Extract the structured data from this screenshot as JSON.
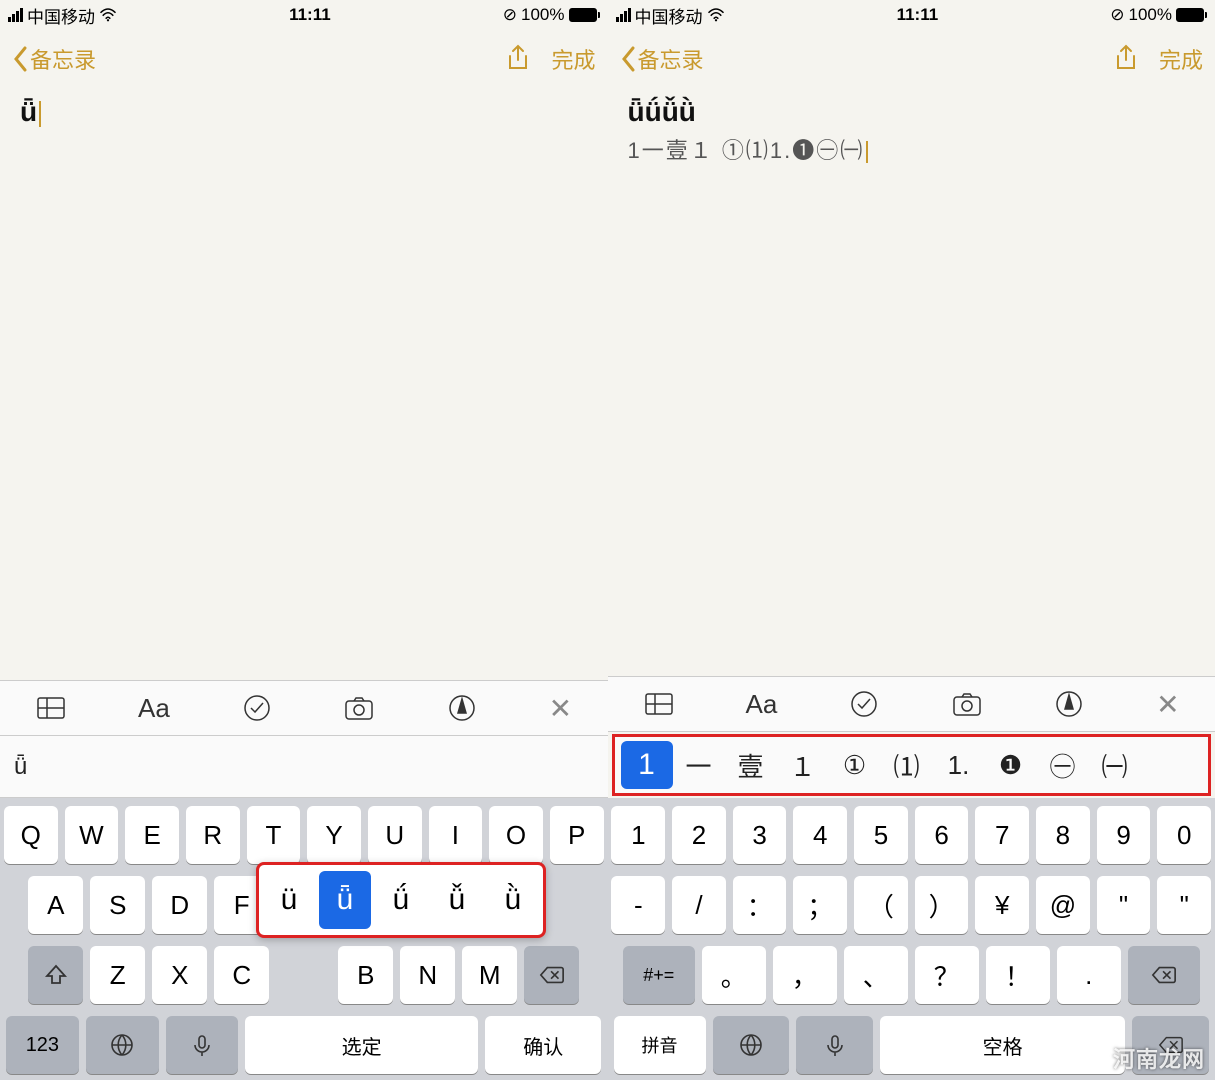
{
  "status": {
    "carrier": "中国移动",
    "time": "11:11",
    "battery": "100%"
  },
  "nav": {
    "back": "备忘录",
    "done": "完成"
  },
  "left": {
    "note_text": "ǖ",
    "candidate": "ǖ",
    "row1": [
      "Q",
      "W",
      "E",
      "R",
      "T",
      "Y",
      "U",
      "I",
      "O",
      "P"
    ],
    "row2": [
      "A",
      "S",
      "D",
      "F"
    ],
    "popup": [
      "ü",
      "ǖ",
      "ǘ",
      "ǚ",
      "ǜ"
    ],
    "popup_selected_index": 1,
    "row3": [
      "Z",
      "X",
      "C",
      "",
      "B",
      "N",
      "M"
    ],
    "bottom": {
      "num": "123",
      "select": "选定",
      "confirm": "确认"
    }
  },
  "right": {
    "note_title": "ǖǘǚǜ",
    "note_body": "1一壹１ ①⑴1.❶㊀㈠",
    "candidates": [
      "1",
      "一",
      "壹",
      "１",
      "①",
      "⑴",
      "1.",
      "❶",
      "㊀",
      "㈠"
    ],
    "selected_index": 0,
    "row1": [
      "1",
      "2",
      "3",
      "4",
      "5",
      "6",
      "7",
      "8",
      "9",
      "0"
    ],
    "row2": [
      "-",
      "/",
      "：",
      "；",
      "（",
      "）",
      "¥",
      "@",
      "\"",
      "\""
    ],
    "row3_label": "#+=",
    "row3": [
      "。",
      "，",
      "、",
      "？",
      "！",
      "."
    ],
    "bottom": {
      "pinyin": "拼音",
      "space": "空格"
    }
  },
  "watermark": "河南龙网"
}
